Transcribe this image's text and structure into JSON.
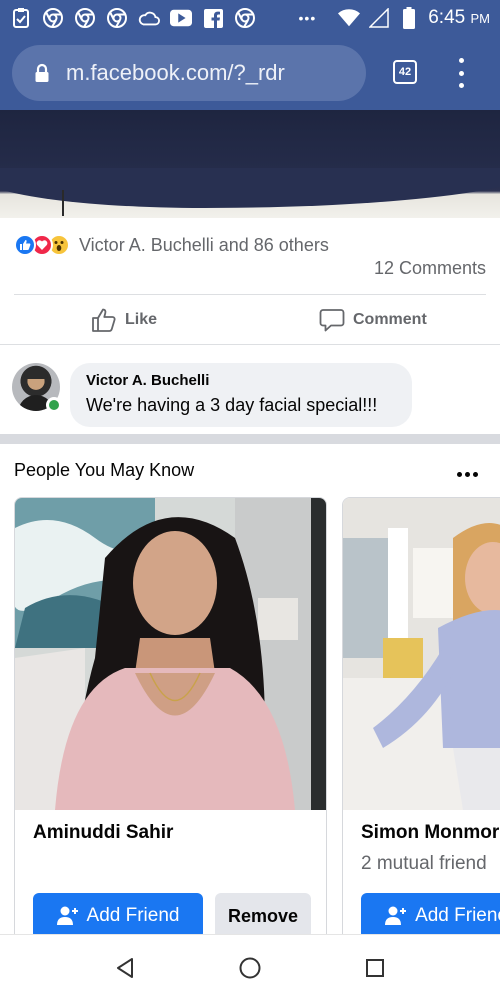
{
  "status_bar": {
    "time": "6:45",
    "ampm": "PM",
    "overflow": "•••",
    "icons": [
      "clipboard-icon",
      "chrome-icon",
      "chrome-icon",
      "chrome-icon",
      "cloud-icon",
      "youtube-icon",
      "facebook-icon",
      "chrome-icon",
      "wifi-icon",
      "signal-icon",
      "battery-icon"
    ]
  },
  "browser": {
    "url": "m.facebook.com/?_rdr",
    "tab_count": "42"
  },
  "post": {
    "reactions_text": "Victor A. Buchelli and 86 others",
    "comments_count": "12 Comments",
    "like_label": "Like",
    "comment_label": "Comment",
    "reaction_icons": [
      "like-reaction-icon",
      "love-reaction-icon",
      "wow-reaction-icon"
    ]
  },
  "comment": {
    "author": "Victor A. Buchelli",
    "text": "We're having a 3 day facial special!!!"
  },
  "pymk": {
    "title": "People You May Know",
    "cards": [
      {
        "name": "Aminuddi Sahir",
        "mutual": "",
        "add_label": "Add Friend",
        "remove_label": "Remove"
      },
      {
        "name": "Simon Monmor",
        "mutual": "2 mutual friend",
        "add_label": "Add Frienc"
      }
    ]
  },
  "colors": {
    "header_blue": "#3d5a99",
    "facebook_blue": "#1a77f2",
    "online_green": "#31a24c"
  }
}
